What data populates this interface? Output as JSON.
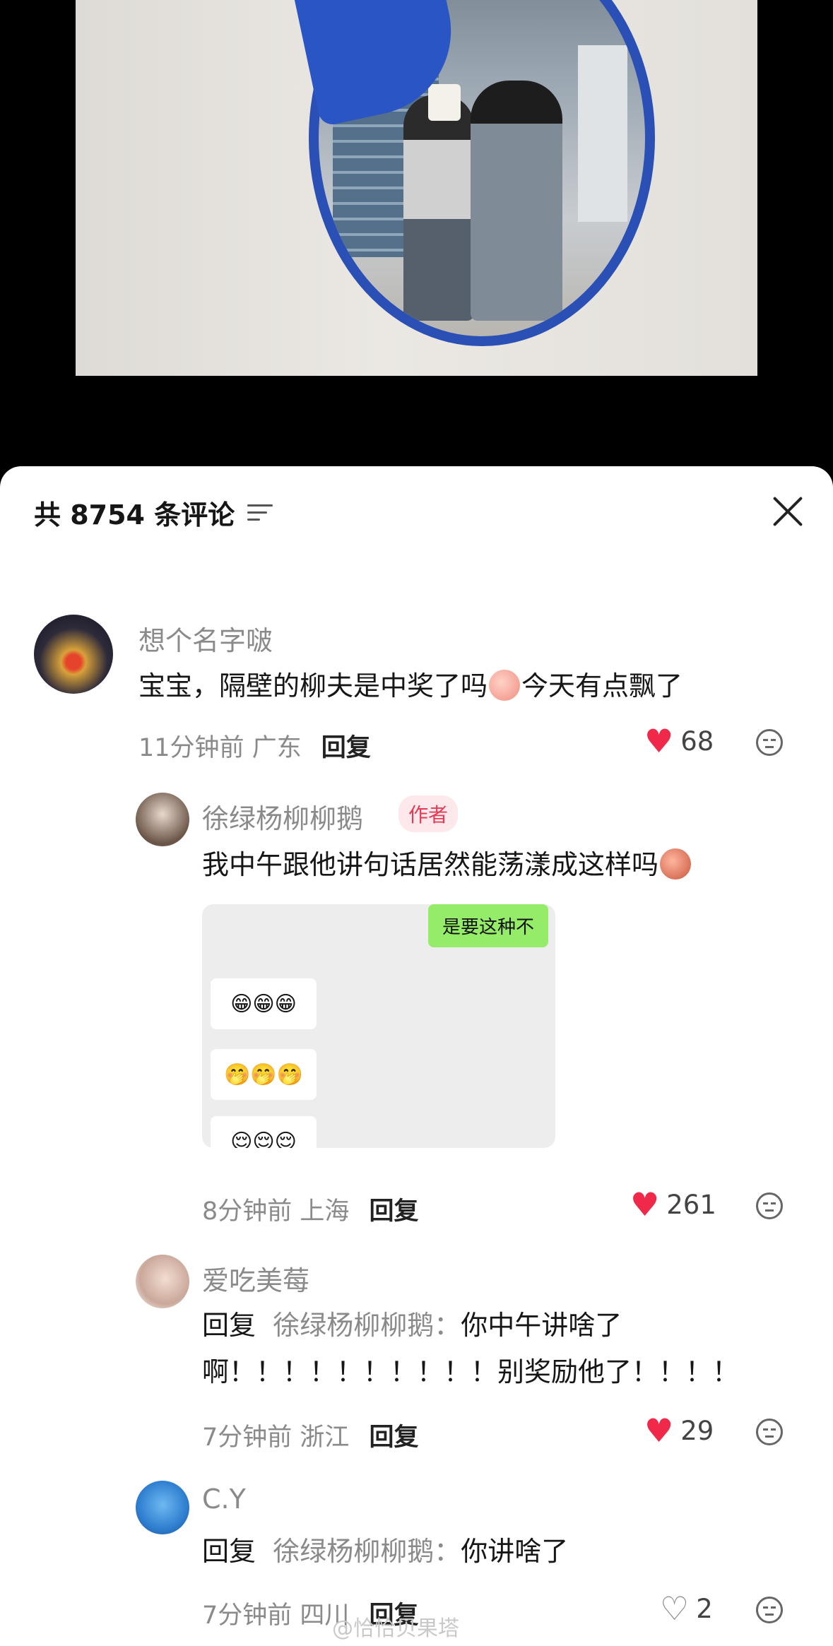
{
  "sheet": {
    "title": "共 8754 条评论"
  },
  "comments": [
    {
      "username": "想个名字啵",
      "text_before": "宝宝，隔壁的柳夫是中奖了吗",
      "text_after": "今天有点飘了",
      "time": "11分钟前",
      "location": "广东",
      "reply_label": "回复",
      "likes": "68"
    },
    {
      "username": "徐绿杨柳柳鹅",
      "author_tag": "作者",
      "text": "我中午跟他讲句话居然能荡漾成这样吗",
      "chat": {
        "green_message": "是要这种不",
        "bubble1": "😁😁😁",
        "bubble2": "🤭🤭🤭",
        "bubble3": "😌😌😌"
      },
      "time": "8分钟前",
      "location": "上海",
      "reply_label": "回复",
      "likes": "261"
    },
    {
      "username": "爱吃美莓",
      "reply_prefix": "回复",
      "reply_to": "徐绿杨柳柳鹅：",
      "text_line1": "你中午讲啥了",
      "text_line2": "啊！！！！！！！！！！别奖励他了！！！！",
      "time": "7分钟前",
      "location": "浙江",
      "reply_label": "回复",
      "likes": "29"
    },
    {
      "username": "C.Y",
      "reply_prefix": "回复",
      "reply_to": "徐绿杨柳柳鹅：",
      "text_line1": "你讲啥了",
      "time": "7分钟前",
      "location": "四川",
      "reply_label": "回复",
      "likes": "2"
    }
  ],
  "watermark": "@恰恰贝果塔",
  "colors": {
    "like_red": "#f0284a",
    "author_tag_bg": "#fde9ec",
    "author_tag_text": "#e33b55",
    "mirror_frame": "#2a4fb5"
  }
}
